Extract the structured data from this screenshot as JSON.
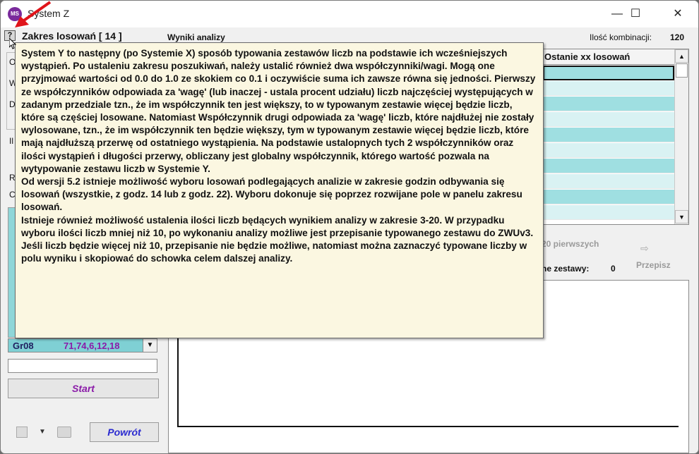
{
  "window": {
    "title": "System Z",
    "icon_text": "MS",
    "minimize": "—",
    "maximize": "☐",
    "close": "✕"
  },
  "header": {
    "help": "?",
    "zakres_title": "Zakres losowań  [ 14 ]",
    "wyniki_label": "Wyniki analizy",
    "ilosc_label": "Ilość kombinacji:",
    "ilosc_value": "120"
  },
  "left": {
    "labels": [
      "O",
      "W",
      "D",
      "Il",
      "R",
      "C"
    ],
    "group_id": "Gr08",
    "group_values": "71,74,6,12,18",
    "start_label": "Start",
    "powrot_label": "Powrót"
  },
  "table": {
    "columns": [
      "Ostanie xx losowań"
    ],
    "row_colors": [
      "#9fdfe1",
      "#d9f2f3"
    ]
  },
  "right": {
    "first_label": "20 pierwszych",
    "zestawy_label": "ne zestawy:",
    "zestawy_value": "0",
    "przepisz_label": "Przepisz"
  },
  "tooltip": {
    "text": "System Y to następny (po Systemie X) sposób typowania zestawów liczb na podstawie ich wcześniejszych wystąpień. Po ustaleniu zakresu poszukiwań, należy ustalić również dwa współczynniki/wagi. Mogą one przyjmować wartości od 0.0 do 1.0 ze skokiem co 0.1 i oczywiście suma ich zawsze równa się jedności. Pierwszy ze współczynników odpowiada za 'wagę' (lub inaczej - ustala procent udziału) liczb najczęściej występujących w zadanym przedziale tzn., że im współczynnik ten jest większy, to w typowanym zestawie więcej będzie liczb, które są częściej losowane. Natomiast Współczynnik drugi odpowiada za 'wagę' liczb, które najdłużej nie zostały wylosowane, tzn., że im współczynnik ten będzie większy, tym w typowanym zestawie więcej będzie liczb, które mają najdłuższą przerwę od ostatniego wystąpienia. Na podstawie ustalopnych tych 2 współczynników oraz ilości wystąpień i długości przerwy, obliczany jest globalny współczynnik, którego wartość pozwala na wytypowanie zestawu liczb w Systemie Y.\nOd wersji 5.2 istnieje możliwość wyboru losowań podlegających analizie w zakresie godzin odbywania się losowań (wszystkie, z godz. 14 lub z godz. 22). Wyboru dokonuje się poprzez rozwijane pole w panelu zakresu losowań.\nIstnieje również możliwość ustalenia ilości liczb będących wynikiem analizy w zakresie 3-20. W przypadku wyboru ilości liczb mniej niż 10, po wykonaniu analizy możliwe jest przepisanie typowanego zestawu do ZWUv3. Jeśli liczb będzie więcej niż 10, przepisanie nie będzie możliwe, natomiast można zaznaczyć typowane liczby w polu wyniku i skopiować do schowka celem dalszej analizy."
  }
}
